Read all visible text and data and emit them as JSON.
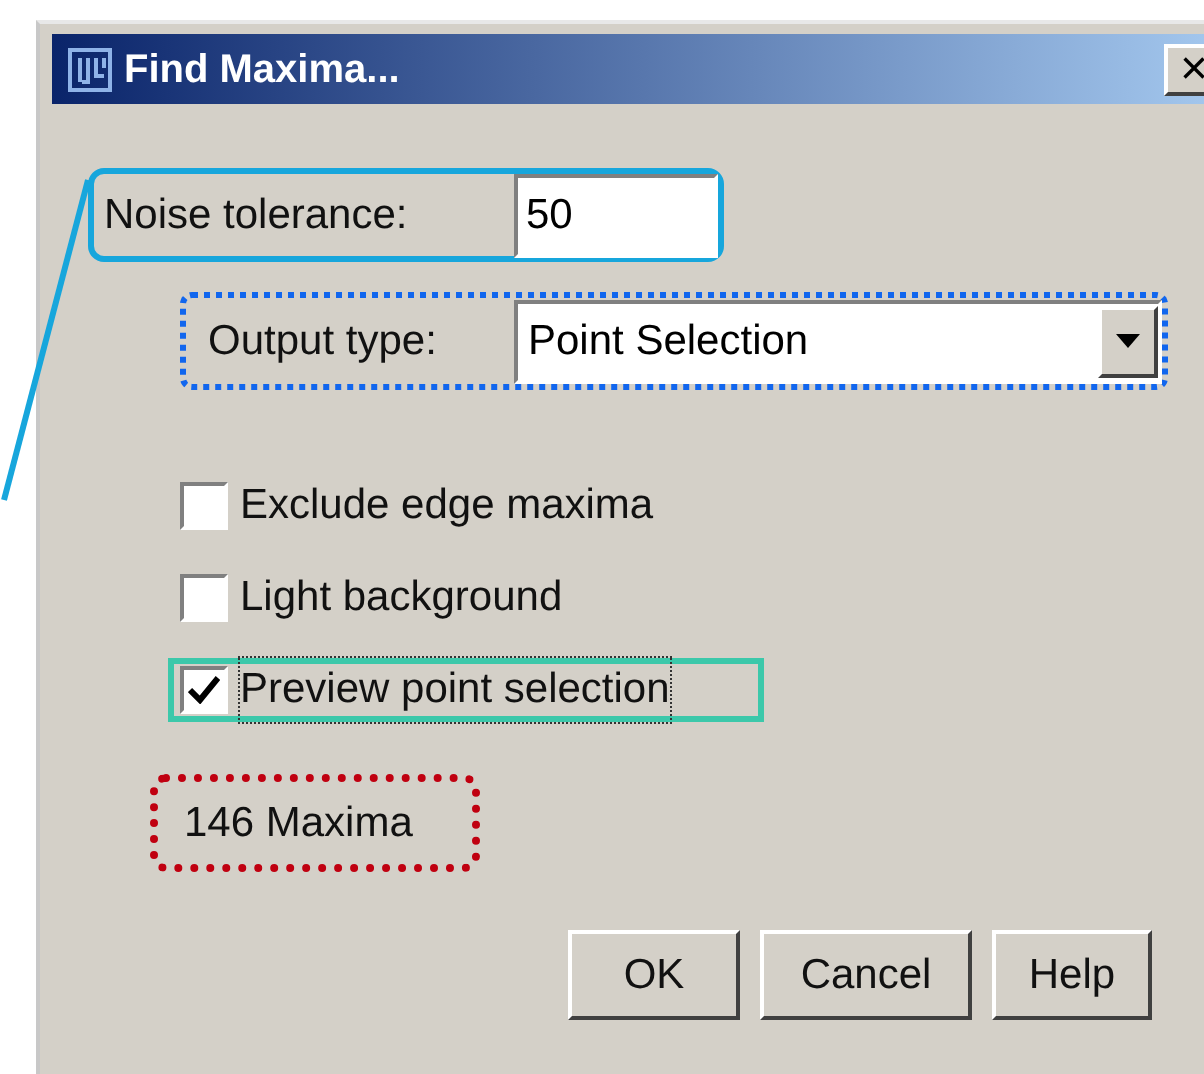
{
  "window": {
    "title": "Find Maxima...",
    "close": "×"
  },
  "noise_tolerance": {
    "label": "Noise tolerance:",
    "value": "50"
  },
  "output_type": {
    "label": "Output type:",
    "value": "Point Selection"
  },
  "checkboxes": [
    {
      "label": "Exclude edge maxima",
      "checked": false,
      "focused": false
    },
    {
      "label": "Light background",
      "checked": false,
      "focused": false
    },
    {
      "label": "Preview point selection",
      "checked": true,
      "focused": true
    }
  ],
  "status": "146 Maxima",
  "buttons": [
    "OK",
    "Cancel",
    "Help"
  ]
}
